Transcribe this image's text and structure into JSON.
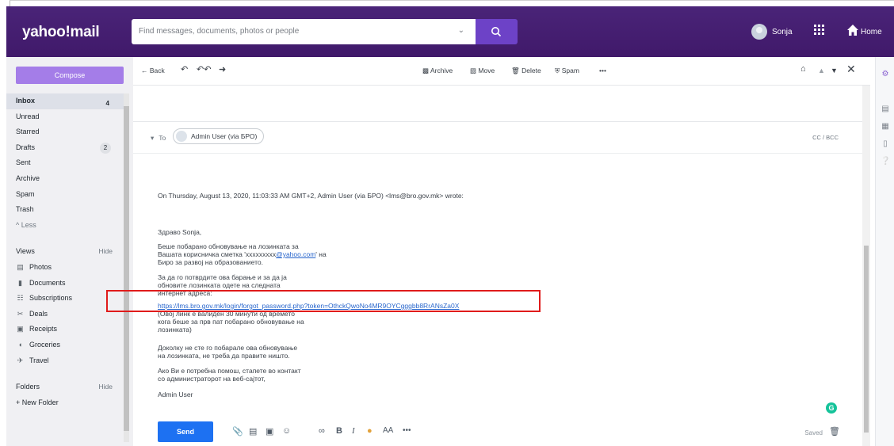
{
  "header": {
    "logo": "yahoo!mail",
    "search_placeholder": "Find messages, documents, photos or people",
    "user_name": "Sonja",
    "home_label": "Home"
  },
  "sidebar": {
    "compose_label": "Compose",
    "folders": [
      {
        "label": "Inbox",
        "count": "4"
      },
      {
        "label": "Unread"
      },
      {
        "label": "Starred"
      },
      {
        "label": "Drafts",
        "count": "2"
      },
      {
        "label": "Sent"
      },
      {
        "label": "Archive"
      },
      {
        "label": "Spam"
      },
      {
        "label": "Trash"
      },
      {
        "label": "^ Less"
      }
    ],
    "views_label": "Views",
    "views_hide": "Hide",
    "views": [
      {
        "label": "Photos",
        "icon": "photos-icon"
      },
      {
        "label": "Documents",
        "icon": "documents-icon"
      },
      {
        "label": "Subscriptions",
        "icon": "subscriptions-icon"
      },
      {
        "label": "Deals",
        "icon": "deals-icon"
      },
      {
        "label": "Receipts",
        "icon": "receipts-icon"
      },
      {
        "label": "Groceries",
        "icon": "groceries-icon"
      },
      {
        "label": "Travel",
        "icon": "travel-icon"
      }
    ],
    "folders_label": "Folders",
    "folders_hide": "Hide",
    "new_folder": "+ New Folder"
  },
  "toolbar": {
    "back": "Back",
    "archive": "Archive",
    "move": "Move",
    "delete": "Delete",
    "spam": "Spam",
    "more": "•••"
  },
  "message": {
    "to_label": "To",
    "recipient": "Admin User (via БРО)",
    "cc_bcc": "CC / BCC",
    "quote_header": "On Thursday, August 13, 2020, 11:03:33 AM GMT+2, Admin User (via БРО) <lms@bro.gov.mk> wrote:",
    "greeting": "Здраво Sonja,",
    "para1_line1": "Беше побарано обновување на лозинката за",
    "para1_line2_pre": "Вашата корисничка сметка 'xxxxxxxxx",
    "para1_line2_link": "@yahoo.com",
    "para1_line2_post": "' на",
    "para1_line3": "Биро за развој на образованието.",
    "para2_line1": "За да го потврдите ова барање и за да ја",
    "para2_line2": "обновите лозинката одете на следната",
    "para2_line3": "интернет адреса:",
    "reset_link": "https://lms.bro.gov.mk/login/forgot_password.php?token=OthckQwoNo4MR9OYCgggbb8RrANsZa0X",
    "para3_line1": "(Овој линк е валиден 30 минути од времето",
    "para3_line2": "кога беше за прв пат побарано обновување на",
    "para3_line3": "лозинката)",
    "para4_line1": "Доколку не сте го побарале ова обновување",
    "para4_line2": "на лозинката, не треба да правите ништо.",
    "para5_line1": "Ако Ви е потребна помош, стапете во контакт",
    "para5_line2": "со администраторот на веб-сајтот,",
    "signature": "Admin User"
  },
  "compose_bar": {
    "send": "Send",
    "saved": "Saved"
  },
  "colors": {
    "header_bg": "#461e70",
    "compose_button": "#a47de8",
    "send_button": "#1d71f2",
    "highlight_box": "#e01b1b"
  }
}
